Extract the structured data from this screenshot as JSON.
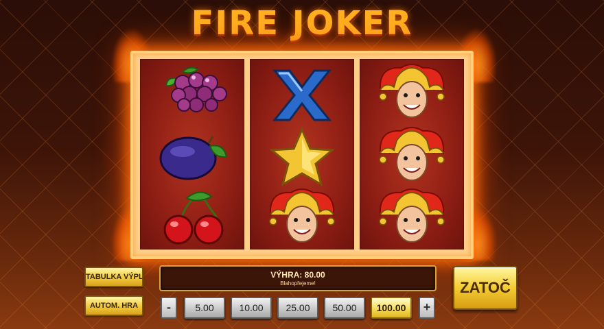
{
  "game": {
    "title": "FIRE JOKER"
  },
  "reels": [
    {
      "symbols": [
        "grapes",
        "plum",
        "cherries"
      ]
    },
    {
      "symbols": [
        "x",
        "star",
        "joker"
      ]
    },
    {
      "symbols": [
        "joker",
        "joker",
        "joker"
      ]
    }
  ],
  "controls": {
    "paytable_label": "TABULKA VÝPLAT",
    "autoplay_label": "AUTOM. HRA",
    "spin_label": "ZATOČ",
    "decrease_label": "-",
    "increase_label": "+"
  },
  "win": {
    "label": "VÝHRA:",
    "amount": "80.00",
    "message": "Blahopřejeme!"
  },
  "bets": {
    "options": [
      "5.00",
      "10.00",
      "25.00",
      "50.00",
      "100.00"
    ],
    "selected": "100.00"
  },
  "colors": {
    "accent_gold": "#ffb020",
    "reel_red": "#8e1e14",
    "frame_glow": "#ff6e0a"
  }
}
